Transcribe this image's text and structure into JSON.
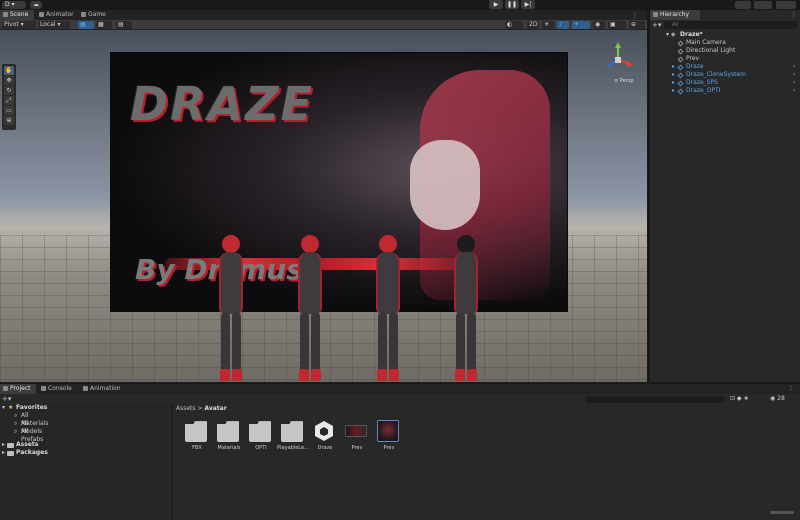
{
  "top": {
    "account_label": "D",
    "cloud_icon": "cloud-icon",
    "play_icon": "play-icon",
    "pause_icon": "pause-icon",
    "step_icon": "step-icon"
  },
  "tabs": {
    "scene": "Scene",
    "animator": "Animator",
    "game": "Game",
    "hierarchy": "Hierarchy",
    "project": "Project",
    "console": "Console",
    "animation": "Animation"
  },
  "scene_toolbar": {
    "pivot": "Pivot",
    "local": "Local",
    "mode_2d": "2D",
    "persp_label": "Persp"
  },
  "scene_art": {
    "title": "DRAZE",
    "subtitle": "By Dnimus"
  },
  "hierarchy": {
    "search_placeholder": "All",
    "root": "Draze*",
    "items": [
      {
        "label": "Main Camera",
        "prefab": false
      },
      {
        "label": "Directional Light",
        "prefab": false
      },
      {
        "label": "Prev",
        "prefab": false
      },
      {
        "label": "Draze",
        "prefab": true
      },
      {
        "label": "Draze_CloneSystem",
        "prefab": true
      },
      {
        "label": "Draze_SPS",
        "prefab": true
      },
      {
        "label": "Draze_OPTI",
        "prefab": true
      }
    ]
  },
  "project": {
    "favorites": "Favorites",
    "fav_items": [
      "All Materials",
      "All Models",
      "All Prefabs"
    ],
    "assets": "Assets",
    "packages": "Packages",
    "breadcrumb_root": "Assets",
    "breadcrumb_sep": ">",
    "breadcrumb_current": "Avatar",
    "count": "28",
    "tiles": [
      "FBX",
      "Materials",
      "OPTI",
      "PlayableLe...",
      "Draze",
      "Prev",
      "Prev"
    ]
  },
  "colors": {
    "accent_blue": "#5fa0e6",
    "brand_red": "#c1272f"
  }
}
